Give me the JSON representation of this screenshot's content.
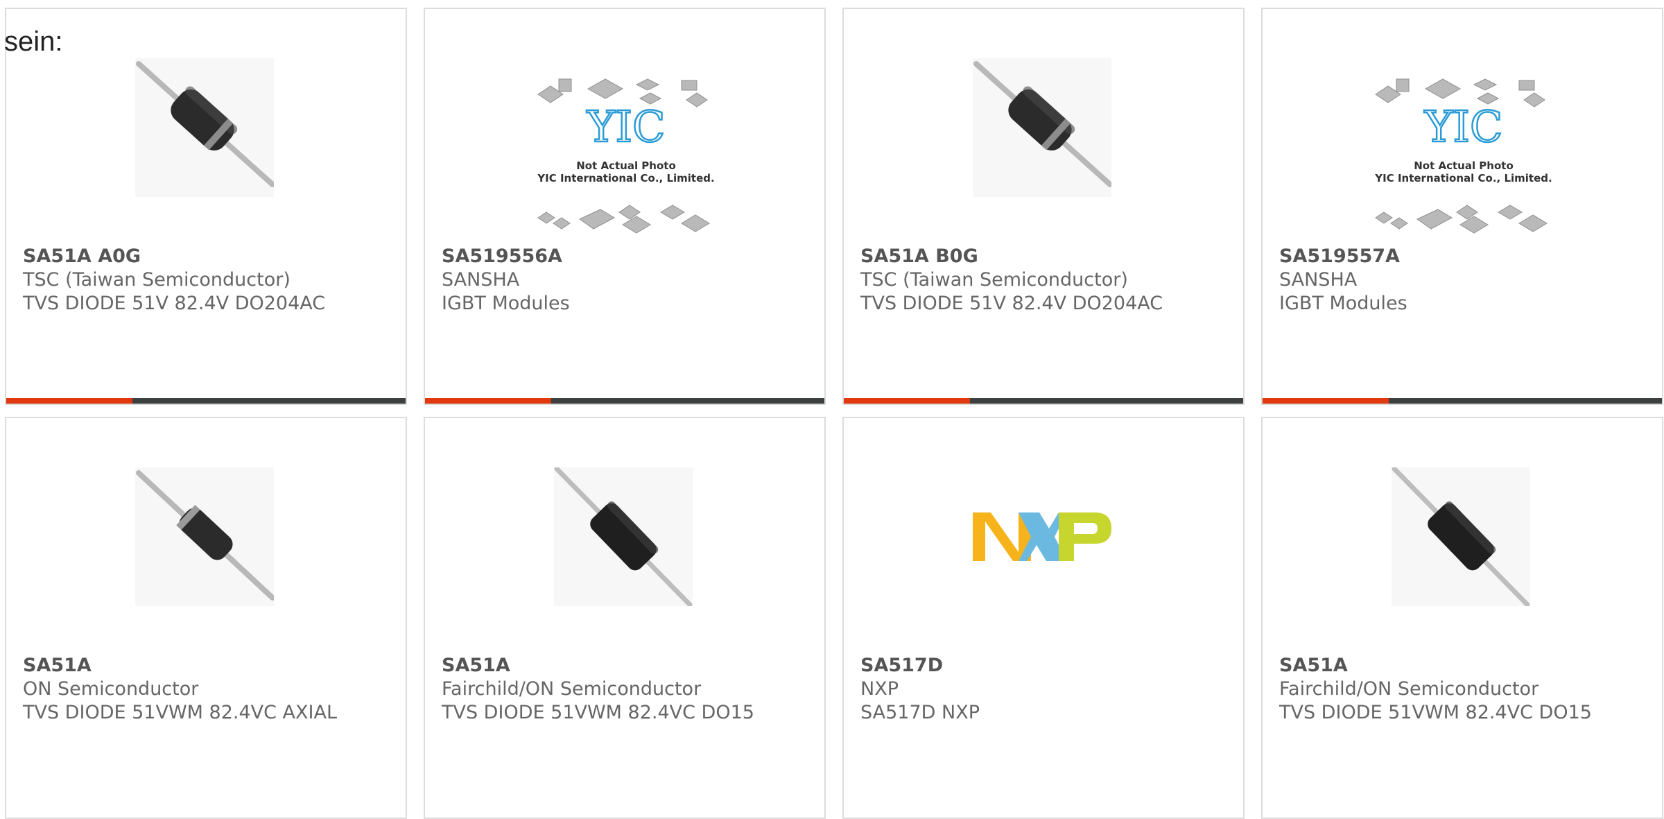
{
  "intro_text": "sein:",
  "colors": {
    "accent": "#e0380f",
    "bar": "#3d4040",
    "card_border": "#dcdcdc"
  },
  "products": [
    {
      "part_number": "SA51A A0G",
      "manufacturer": "TSC (Taiwan Semiconductor)",
      "description": "TVS DIODE 51V 82.4V DO204AC",
      "image": "axial-diode-icon"
    },
    {
      "part_number": "SA519556A",
      "manufacturer": "SANSHA",
      "description": "IGBT Modules",
      "image": "not-actual-photo-placeholder",
      "image_caption_1": "Not Actual Photo",
      "image_caption_2": "YIC International Co., Limited.",
      "image_logo": "YIC"
    },
    {
      "part_number": "SA51A B0G",
      "manufacturer": "TSC (Taiwan Semiconductor)",
      "description": "TVS DIODE 51V 82.4V DO204AC",
      "image": "axial-diode-icon"
    },
    {
      "part_number": "SA519557A",
      "manufacturer": "SANSHA",
      "description": "IGBT Modules",
      "image": "not-actual-photo-placeholder",
      "image_caption_1": "Not Actual Photo",
      "image_caption_2": "YIC International Co., Limited.",
      "image_logo": "YIC"
    },
    {
      "part_number": "SA51A",
      "manufacturer": "ON Semiconductor",
      "description": "TVS DIODE 51VWM 82.4VC AXIAL",
      "image": "axial-diode-icon"
    },
    {
      "part_number": "SA51A",
      "manufacturer": "Fairchild/ON Semiconductor",
      "description": "TVS DIODE 51VWM 82.4VC DO15",
      "image": "axial-diode-icon"
    },
    {
      "part_number": "SA517D",
      "manufacturer": "NXP",
      "description": "SA517D NXP",
      "image": "nxp-logo"
    },
    {
      "part_number": "SA51A",
      "manufacturer": "Fairchild/ON Semiconductor",
      "description": "TVS DIODE 51VWM 82.4VC DO15",
      "image": "axial-diode-icon"
    }
  ]
}
